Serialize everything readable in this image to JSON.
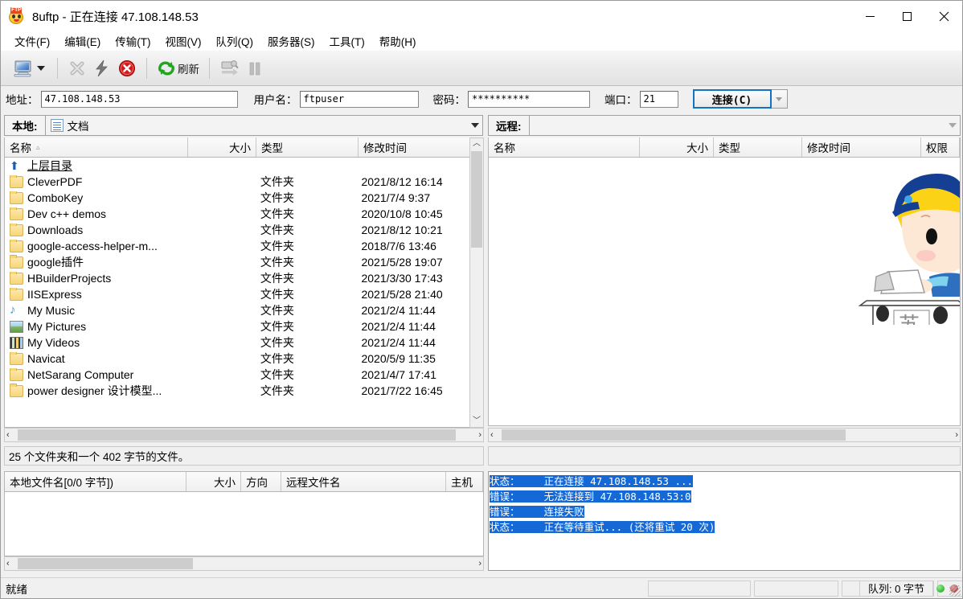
{
  "window": {
    "app_name": "8uftp",
    "title": "8uftp - 正在连接 47.108.148.53",
    "icon": "ftp-face-icon",
    "minimize": "−",
    "maximize": "□",
    "close": "✕"
  },
  "menubar": {
    "items": [
      {
        "label": "文件(F)",
        "name": "menu-file"
      },
      {
        "label": "编辑(E)",
        "name": "menu-edit"
      },
      {
        "label": "传输(T)",
        "name": "menu-transfer"
      },
      {
        "label": "视图(V)",
        "name": "menu-view"
      },
      {
        "label": "队列(Q)",
        "name": "menu-queue"
      },
      {
        "label": "服务器(S)",
        "name": "menu-server"
      },
      {
        "label": "工具(T)",
        "name": "menu-tools"
      },
      {
        "label": "帮助(H)",
        "name": "menu-help"
      }
    ]
  },
  "toolbar": {
    "site_manager": "site-manager-icon",
    "dropdown": "chevron-down-icon",
    "disconnect": "disconnect-x-icon",
    "quick_connect": "lightning-icon",
    "stop": "stop-circle-icon",
    "refresh_icon": "refresh-icon",
    "refresh_label": "刷新",
    "transfer_queue": "transfer-queue-icon",
    "pause": "pause-icon"
  },
  "connection": {
    "address_label": "地址：",
    "address_value": "47.108.148.53",
    "username_label": "用户名：",
    "username_value": "ftpuser",
    "password_label": "密码：",
    "password_value": "**********",
    "port_label": "端口：",
    "port_value": "21",
    "connect_button": "连接(C)",
    "connect_dropdown": "chevron-down-icon"
  },
  "local_panel": {
    "tab_label": "本地:",
    "path_icon": "documents-icon",
    "path_value": "文档",
    "columns": [
      {
        "label": "名称",
        "sort": "▵",
        "align": "left"
      },
      {
        "label": "大小",
        "align": "right"
      },
      {
        "label": "类型",
        "align": "left"
      },
      {
        "label": "修改时间",
        "align": "left"
      }
    ],
    "rows": [
      {
        "icon": "up-arrow-icon",
        "name": "上层目录",
        "size": "",
        "type": "",
        "date": "",
        "parent": true
      },
      {
        "icon": "folder-icon",
        "name": "CleverPDF",
        "size": "",
        "type": "文件夹",
        "date": "2021/8/12 16:14"
      },
      {
        "icon": "folder-icon",
        "name": "ComboKey",
        "size": "",
        "type": "文件夹",
        "date": "2021/7/4 9:37"
      },
      {
        "icon": "folder-icon",
        "name": "Dev c++ demos",
        "size": "",
        "type": "文件夹",
        "date": "2020/10/8 10:45"
      },
      {
        "icon": "folder-icon",
        "name": "Downloads",
        "size": "",
        "type": "文件夹",
        "date": "2021/8/12 10:21"
      },
      {
        "icon": "folder-icon",
        "name": "google-access-helper-m...",
        "size": "",
        "type": "文件夹",
        "date": "2018/7/6 13:46"
      },
      {
        "icon": "folder-icon",
        "name": "google插件",
        "size": "",
        "type": "文件夹",
        "date": "2021/5/28 19:07"
      },
      {
        "icon": "folder-icon",
        "name": "HBuilderProjects",
        "size": "",
        "type": "文件夹",
        "date": "2021/3/30 17:43"
      },
      {
        "icon": "folder-icon",
        "name": "IISExpress",
        "size": "",
        "type": "文件夹",
        "date": "2021/5/28 21:40"
      },
      {
        "icon": "music-icon",
        "name": "My Music",
        "size": "",
        "type": "文件夹",
        "date": "2021/2/4 11:44"
      },
      {
        "icon": "picture-icon",
        "name": "My Pictures",
        "size": "",
        "type": "文件夹",
        "date": "2021/2/4 11:44"
      },
      {
        "icon": "video-icon",
        "name": "My Videos",
        "size": "",
        "type": "文件夹",
        "date": "2021/2/4 11:44"
      },
      {
        "icon": "folder-icon",
        "name": "Navicat",
        "size": "",
        "type": "文件夹",
        "date": "2020/5/9 11:35"
      },
      {
        "icon": "folder-icon",
        "name": "NetSarang Computer",
        "size": "",
        "type": "文件夹",
        "date": "2021/4/7 17:41"
      },
      {
        "icon": "folder-icon",
        "name": "power designer 设计模型...",
        "size": "",
        "type": "文件夹",
        "date": "2021/7/22 16:45"
      }
    ],
    "status_text": "25 个文件夹和一个 402 字节的文件。"
  },
  "remote_panel": {
    "tab_label": "远程:",
    "path_value": "",
    "columns": [
      {
        "label": "名称",
        "align": "left"
      },
      {
        "label": "大小",
        "align": "right"
      },
      {
        "label": "类型",
        "align": "left"
      },
      {
        "label": "修改时间",
        "align": "left"
      },
      {
        "label": "权限",
        "align": "left"
      }
    ],
    "rows": [],
    "mascot": "mascot-boy-laptop-image"
  },
  "queue_panel": {
    "columns": [
      {
        "label": "本地文件名[0/0 字节])",
        "align": "left"
      },
      {
        "label": "大小",
        "align": "right"
      },
      {
        "label": "方向",
        "align": "left"
      },
      {
        "label": "远程文件名",
        "align": "left"
      },
      {
        "label": "主机",
        "align": "left"
      }
    ],
    "rows": []
  },
  "log_panel": {
    "lines": [
      {
        "label": "状态：",
        "text": "正在连接 47.108.148.53 ...",
        "selected": true
      },
      {
        "label": "错误：",
        "text": "无法连接到 47.108.148.53:0",
        "selected": true
      },
      {
        "label": "错误：",
        "text": "连接失败",
        "selected": true
      },
      {
        "label": "状态：",
        "text": "正在等待重试... (还将重试 20 次)",
        "selected": true
      }
    ]
  },
  "statusbar": {
    "ready_text": "就绪",
    "cells": [
      "",
      "",
      "",
      ""
    ],
    "queue_text": "队列: 0 字节",
    "led_green": "status-led-green",
    "led_red": "status-led-red",
    "resize_grip": "resize-grip-icon"
  },
  "colors": {
    "accent": "#1569d6",
    "connect_border": "#1273c4",
    "folder": "#f7d677",
    "window_bg": "#f0f0f0"
  }
}
